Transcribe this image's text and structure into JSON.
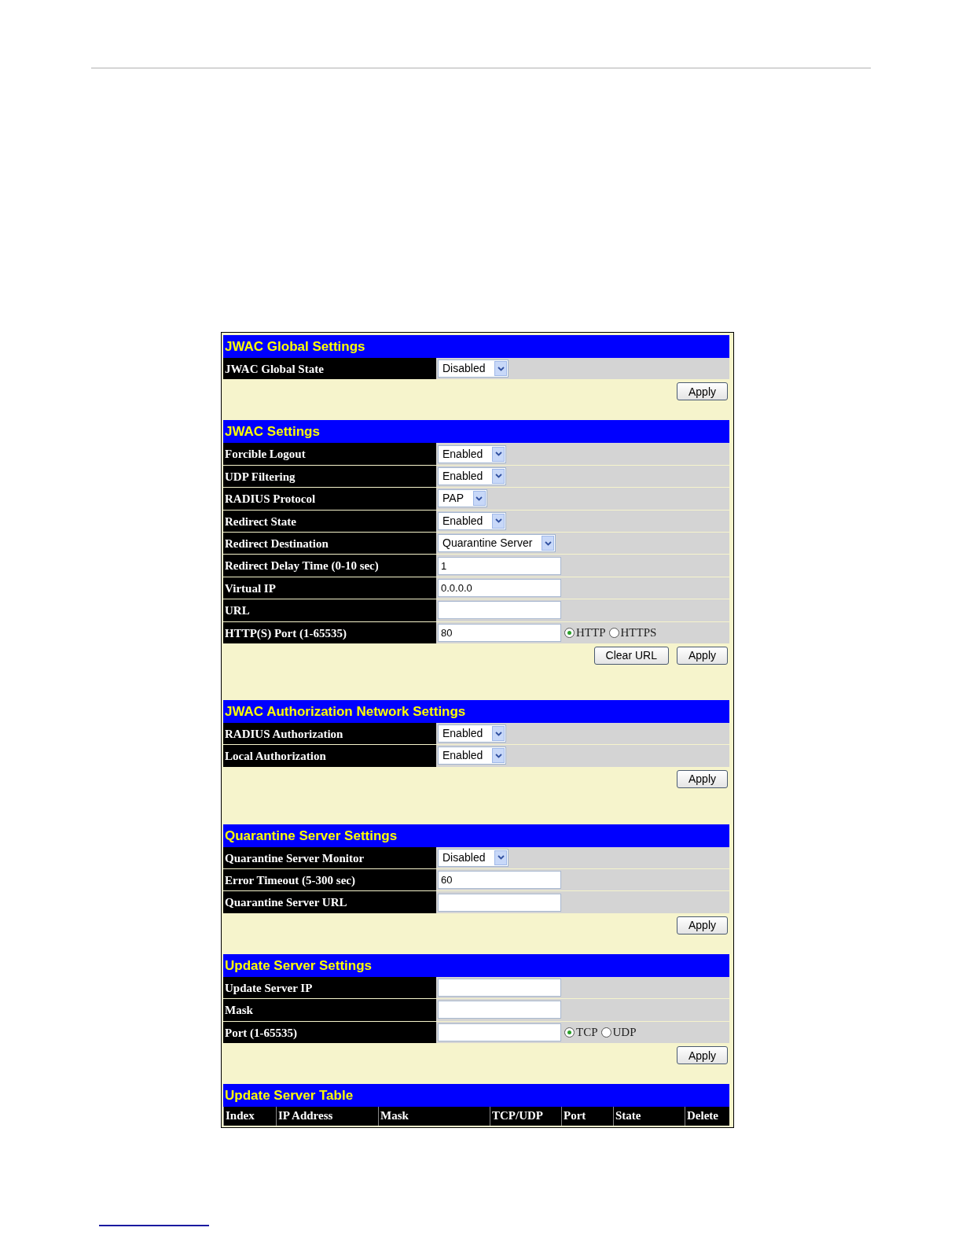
{
  "sections": [
    {
      "title": "JWAC Global Settings",
      "rows": [
        {
          "label": "JWAC Global State",
          "kind": "select",
          "value": "Disabled"
        }
      ],
      "buttons": [
        "Apply"
      ]
    },
    {
      "title": "JWAC Settings",
      "rows": [
        {
          "label": "Forcible Logout",
          "kind": "select",
          "value": "Enabled"
        },
        {
          "label": "UDP Filtering",
          "kind": "select",
          "value": "Enabled"
        },
        {
          "label": "RADIUS Protocol",
          "kind": "select",
          "value": "PAP"
        },
        {
          "label": "Redirect State",
          "kind": "select",
          "value": "Enabled"
        },
        {
          "label": "Redirect Destination",
          "kind": "select",
          "value": "Quarantine Server"
        },
        {
          "label": "Redirect Delay Time (0-10 sec)",
          "kind": "text",
          "value": "1"
        },
        {
          "label": "Virtual IP",
          "kind": "text",
          "value": "0.0.0.0"
        },
        {
          "label": "URL",
          "kind": "text",
          "value": ""
        },
        {
          "label": "HTTP(S) Port (1-65535)",
          "kind": "text",
          "value": "80",
          "radios": [
            {
              "label": "HTTP",
              "selected": true
            },
            {
              "label": "HTTPS",
              "selected": false
            }
          ]
        }
      ],
      "buttons": [
        "Clear URL",
        "Apply"
      ]
    },
    {
      "title": "JWAC Authorization Network Settings",
      "rows": [
        {
          "label": "RADIUS Authorization",
          "kind": "select",
          "value": "Enabled"
        },
        {
          "label": "Local Authorization",
          "kind": "select",
          "value": "Enabled"
        }
      ],
      "buttons": [
        "Apply"
      ]
    },
    {
      "title": "Quarantine Server Settings",
      "rows": [
        {
          "label": "Quarantine Server Monitor",
          "kind": "select",
          "value": "Disabled"
        },
        {
          "label": "Error Timeout (5-300 sec)",
          "kind": "text",
          "value": "60"
        },
        {
          "label": "Quarantine Server URL",
          "kind": "text",
          "value": ""
        }
      ],
      "buttons": [
        "Apply"
      ]
    },
    {
      "title": "Update Server Settings",
      "rows": [
        {
          "label": "Update Server IP",
          "kind": "text",
          "value": ""
        },
        {
          "label": "Mask",
          "kind": "text",
          "value": ""
        },
        {
          "label": "Port (1-65535)",
          "kind": "text",
          "value": "",
          "radios": [
            {
              "label": "TCP",
              "selected": true
            },
            {
              "label": "UDP",
              "selected": false
            }
          ]
        }
      ],
      "buttons": [
        "Apply"
      ]
    }
  ],
  "table": {
    "title": "Update Server Table",
    "columns": [
      "Index",
      "IP Address",
      "Mask",
      "TCP/UDP",
      "Port",
      "State",
      "Delete"
    ]
  }
}
